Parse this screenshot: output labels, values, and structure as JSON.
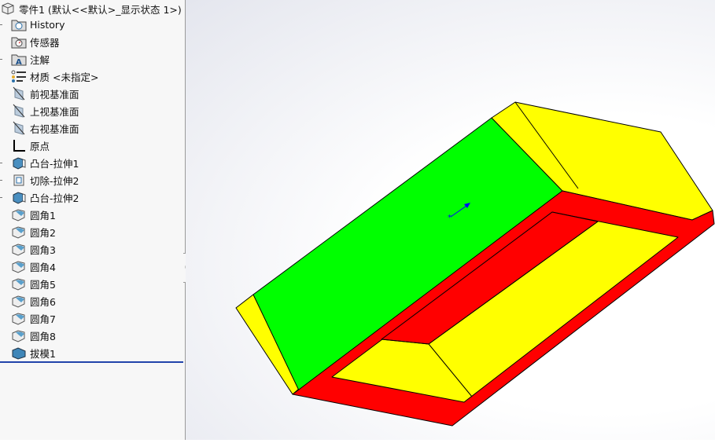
{
  "tree": {
    "root": "零件1  (默认<<默认>_显示状态 1>)",
    "items": [
      {
        "label": "History",
        "icon": "history-folder-icon"
      },
      {
        "label": "传感器",
        "icon": "sensor-folder-icon"
      },
      {
        "label": "注解",
        "icon": "annotation-folder-icon"
      },
      {
        "label": "材质 <未指定>",
        "icon": "material-icon"
      },
      {
        "label": "前视基准面",
        "icon": "plane-icon"
      },
      {
        "label": "上视基准面",
        "icon": "plane-icon"
      },
      {
        "label": "右视基准面",
        "icon": "plane-icon"
      },
      {
        "label": "原点",
        "icon": "origin-icon"
      },
      {
        "label": "凸台-拉伸1",
        "icon": "boss-extrude-icon"
      },
      {
        "label": "切除-拉伸2",
        "icon": "cut-extrude-icon"
      },
      {
        "label": "凸台-拉伸2",
        "icon": "boss-extrude-icon"
      },
      {
        "label": "圆角1",
        "icon": "fillet-icon"
      },
      {
        "label": "圆角2",
        "icon": "fillet-icon"
      },
      {
        "label": "圆角3",
        "icon": "fillet-icon"
      },
      {
        "label": "圆角4",
        "icon": "fillet-icon"
      },
      {
        "label": "圆角5",
        "icon": "fillet-icon"
      },
      {
        "label": "圆角6",
        "icon": "fillet-icon"
      },
      {
        "label": "圆角7",
        "icon": "fillet-icon"
      },
      {
        "label": "圆角8",
        "icon": "fillet-icon"
      },
      {
        "label": "拔模1",
        "icon": "draft-icon"
      }
    ]
  },
  "colors": {
    "green": "#00ff00",
    "yellow": "#ffff00",
    "red": "#ff0000",
    "selection": "#2244aa"
  }
}
